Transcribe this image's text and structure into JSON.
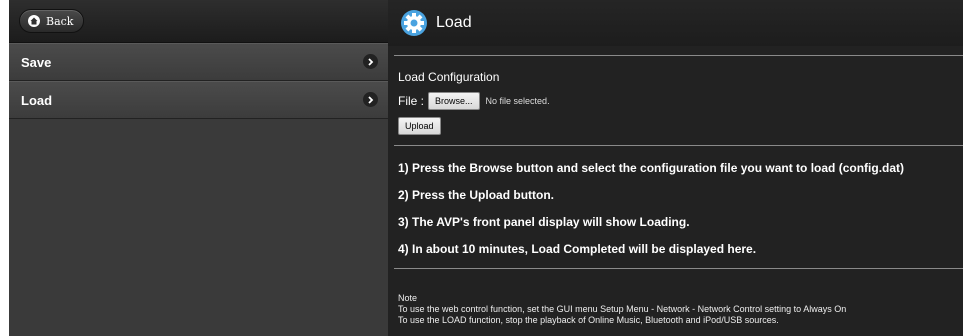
{
  "sidebar": {
    "back_label": "Back",
    "items": [
      {
        "label": "Save"
      },
      {
        "label": "Load"
      }
    ]
  },
  "main": {
    "title": "Load",
    "config_title": "Load Configuration",
    "file_label": "File :",
    "browse_label": "Browse...",
    "no_file_text": "No file selected.",
    "upload_label": "Upload",
    "steps": [
      "1) Press the Browse button and select the configuration file you want to load (config.dat)",
      "2) Press the Upload button.",
      "3) The AVP's front panel display will show Loading.",
      "4) In about 10 minutes, Load Completed will be displayed here."
    ],
    "note_title": "Note",
    "note_lines": [
      "To use the web control function, set the GUI menu Setup Menu - Network - Network Control setting to Always On",
      "To use the LOAD function, stop the playback of Online Music, Bluetooth and iPod/USB sources."
    ]
  },
  "icons": {
    "home": "home-icon",
    "chevron": "chevron-right-icon",
    "gear": "gear-icon"
  }
}
